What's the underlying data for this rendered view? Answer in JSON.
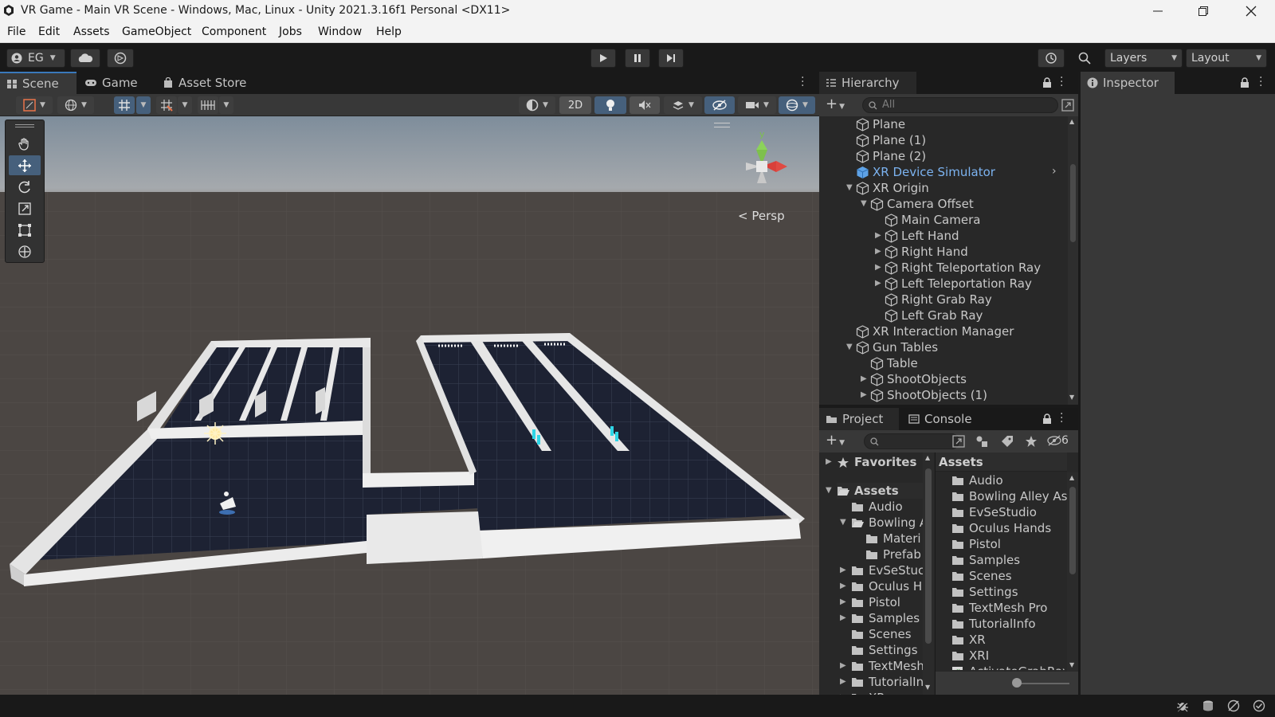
{
  "window": {
    "title": "VR Game - Main VR Scene - Windows, Mac, Linux - Unity 2021.3.16f1 Personal <DX11>"
  },
  "menu": [
    "File",
    "Edit",
    "Assets",
    "GameObject",
    "Component",
    "Jobs",
    "Window",
    "Help"
  ],
  "toolbar": {
    "account": "EG",
    "layers": "Layers",
    "layout": "Layout"
  },
  "scene_tabs": [
    {
      "label": "Scene",
      "icon": "scene-icon",
      "active": true
    },
    {
      "label": "Game",
      "icon": "gamepad-icon",
      "active": false
    },
    {
      "label": "Asset Store",
      "icon": "shopping-bag-icon",
      "active": false
    }
  ],
  "scene_toolbar": {
    "mode_2d": "2D",
    "persp": "Persp",
    "gizmo_y": "y"
  },
  "hierarchy": {
    "tab": "Hierarchy",
    "search_placeholder": "All",
    "items": [
      {
        "label": "Plane",
        "depth": 0,
        "expander": "",
        "highlight": false
      },
      {
        "label": "Plane (1)",
        "depth": 0,
        "expander": "",
        "highlight": false
      },
      {
        "label": "Plane (2)",
        "depth": 0,
        "expander": "",
        "highlight": false
      },
      {
        "label": "XR Device Simulator",
        "depth": 0,
        "expander": "",
        "highlight": true
      },
      {
        "label": "XR Origin",
        "depth": 0,
        "expander": "open",
        "highlight": false
      },
      {
        "label": "Camera Offset",
        "depth": 1,
        "expander": "open",
        "highlight": false
      },
      {
        "label": "Main Camera",
        "depth": 2,
        "expander": "",
        "highlight": false
      },
      {
        "label": "Left Hand",
        "depth": 2,
        "expander": "closed",
        "highlight": false
      },
      {
        "label": "Right Hand",
        "depth": 2,
        "expander": "closed",
        "highlight": false
      },
      {
        "label": "Right Teleportation Ray",
        "depth": 2,
        "expander": "closed",
        "highlight": false
      },
      {
        "label": "Left Teleportation Ray",
        "depth": 2,
        "expander": "closed",
        "highlight": false
      },
      {
        "label": "Right Grab Ray",
        "depth": 2,
        "expander": "",
        "highlight": false
      },
      {
        "label": "Left Grab Ray",
        "depth": 2,
        "expander": "",
        "highlight": false
      },
      {
        "label": "XR Interaction Manager",
        "depth": 0,
        "expander": "",
        "highlight": false
      },
      {
        "label": "Gun Tables",
        "depth": 0,
        "expander": "open",
        "highlight": false
      },
      {
        "label": "Table",
        "depth": 1,
        "expander": "",
        "highlight": false
      },
      {
        "label": "ShootObjects",
        "depth": 1,
        "expander": "closed",
        "highlight": false
      },
      {
        "label": "ShootObjects (1)",
        "depth": 1,
        "expander": "closed",
        "highlight": false
      }
    ]
  },
  "inspector": {
    "tab": "Inspector"
  },
  "project": {
    "tabs": [
      "Project",
      "Console"
    ],
    "hidden_count": "6",
    "tree": [
      {
        "label": "Favorites",
        "depth": 0,
        "expander": "closed",
        "kind": "star",
        "bold": true
      },
      {
        "label": "Assets",
        "depth": 0,
        "expander": "open",
        "kind": "folder-open",
        "bold": true
      },
      {
        "label": "Audio",
        "depth": 1,
        "expander": "",
        "kind": "folder",
        "bold": false
      },
      {
        "label": "Bowling A",
        "depth": 1,
        "expander": "open",
        "kind": "folder-open",
        "bold": false
      },
      {
        "label": "Materi",
        "depth": 2,
        "expander": "",
        "kind": "folder",
        "bold": false
      },
      {
        "label": "Prefab",
        "depth": 2,
        "expander": "",
        "kind": "folder",
        "bold": false
      },
      {
        "label": "EvSeStuc",
        "depth": 1,
        "expander": "closed",
        "kind": "folder",
        "bold": false
      },
      {
        "label": "Oculus H",
        "depth": 1,
        "expander": "closed",
        "kind": "folder",
        "bold": false
      },
      {
        "label": "Pistol",
        "depth": 1,
        "expander": "closed",
        "kind": "folder",
        "bold": false
      },
      {
        "label": "Samples",
        "depth": 1,
        "expander": "closed",
        "kind": "folder",
        "bold": false
      },
      {
        "label": "Scenes",
        "depth": 1,
        "expander": "",
        "kind": "folder",
        "bold": false
      },
      {
        "label": "Settings",
        "depth": 1,
        "expander": "",
        "kind": "folder",
        "bold": false
      },
      {
        "label": "TextMesh",
        "depth": 1,
        "expander": "closed",
        "kind": "folder",
        "bold": false
      },
      {
        "label": "TutorialIn",
        "depth": 1,
        "expander": "closed",
        "kind": "folder",
        "bold": false
      },
      {
        "label": "XR",
        "depth": 1,
        "expander": "closed",
        "kind": "folder",
        "bold": false
      }
    ],
    "assets_header": "Assets",
    "assets": [
      {
        "label": "Audio",
        "kind": "folder"
      },
      {
        "label": "Bowling Alley As",
        "kind": "folder"
      },
      {
        "label": "EvSeStudio",
        "kind": "folder"
      },
      {
        "label": "Oculus Hands",
        "kind": "folder"
      },
      {
        "label": "Pistol",
        "kind": "folder"
      },
      {
        "label": "Samples",
        "kind": "folder"
      },
      {
        "label": "Scenes",
        "kind": "folder"
      },
      {
        "label": "Settings",
        "kind": "folder"
      },
      {
        "label": "TextMesh Pro",
        "kind": "folder"
      },
      {
        "label": "TutorialInfo",
        "kind": "folder"
      },
      {
        "label": "XR",
        "kind": "folder"
      },
      {
        "label": "XRI",
        "kind": "folder"
      },
      {
        "label": "ActivateGrabRay",
        "kind": "script"
      }
    ]
  },
  "colors": {
    "accent": "#3a79bb",
    "highlight_text": "#7cb3f0",
    "selected_tool": "#46607c",
    "panel": "#282828",
    "toolbar": "#383838"
  }
}
